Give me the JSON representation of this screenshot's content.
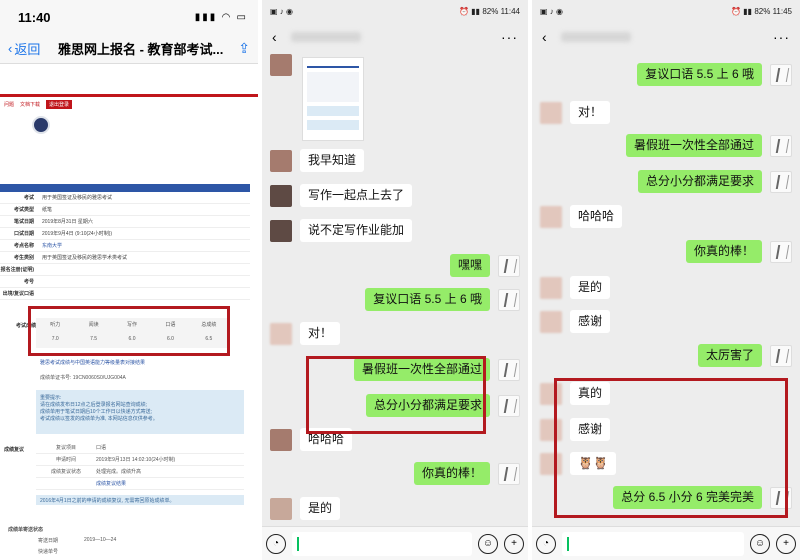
{
  "panel1": {
    "status_time": "11:40",
    "back_label": "返回",
    "title": "雅思网上报名 - 教育部考试...",
    "links": [
      "问题",
      "文档下载",
      "退出登录"
    ],
    "rows": [
      {
        "k": "考试",
        "v": "用于英国签证及移民的雅思考试"
      },
      {
        "k": "考试类型",
        "v": "纸笔"
      },
      {
        "k": "笔试日期",
        "v": "2019年8月31日 星期六"
      },
      {
        "k": "口试日期",
        "v": "2019年9月4日 (9:10(24小时制))"
      },
      {
        "k": "考点名称",
        "v": "东南大学"
      },
      {
        "k": "考生类别",
        "v": "用于英国签证及移民的雅思学术类考试"
      },
      {
        "k": "报名注册(证明)",
        "v": ""
      },
      {
        "k": "考号",
        "v": ""
      },
      {
        "k": "出境/复议口语",
        "v": ""
      }
    ],
    "score_label": "考试成绩",
    "score_headers": [
      "听力",
      "阅读",
      "写作",
      "口语",
      "总成绩"
    ],
    "score_values": [
      "7.0",
      "7.5",
      "6.0",
      "6.0",
      "6.5"
    ],
    "score_note": "雅思考试成绩与中国英语能力等级量表对接结果",
    "report_no": "成绩单证书号: 19CN0060S0/UJG004A",
    "notice_title": "重要提示:",
    "notice_lines": [
      "请在成绩发布日12点之后登录报名网站查询成绩;",
      "成绩单用于笔试日期后10个工作日以快递方式寄送;",
      "考试成绩以签发的成绩单为准, 本网站信息仅供参考。"
    ],
    "recheck_label": "成绩复议",
    "recheck_rows": [
      {
        "k": "复议项目",
        "v": "口语"
      },
      {
        "k": "申请时间",
        "v": "2019年9月13日 14:02:10(24小时制)"
      },
      {
        "k": "成绩复议状态",
        "v": "处理完成。成绩升高"
      },
      {
        "k": "",
        "v": "成绩复议结果"
      }
    ],
    "recheck_note": "2016年4月1日之前的申请的成绩复议, 无需寄回原始成绩单。",
    "express_label": "成绩单寄送状态",
    "express_rows": [
      {
        "k": "寄送日期",
        "v": "2019—10—24"
      },
      {
        "k": "快递单号",
        "v": ""
      }
    ]
  },
  "panel2": {
    "status_time": "11:44",
    "battery": "82%",
    "messages": [
      {
        "side": "l",
        "text": "我早知道"
      },
      {
        "side": "l",
        "text": "写作一起点上去了"
      },
      {
        "side": "l",
        "text": "说不定写作业能加"
      },
      {
        "side": "r",
        "text": "嘿嘿"
      },
      {
        "side": "r",
        "text": "复议口语 5.5 上 6 哦"
      },
      {
        "side": "l",
        "text": "对！"
      },
      {
        "side": "r",
        "text": "暑假班一次性全部通过"
      },
      {
        "side": "r",
        "text": "总分小分都满足要求"
      },
      {
        "side": "l",
        "text": "哈哈哈"
      },
      {
        "side": "r",
        "text": "你真的棒！"
      },
      {
        "side": "l",
        "text": "是的"
      }
    ]
  },
  "panel3": {
    "status_time": "11:45",
    "battery": "82%",
    "messages": [
      {
        "side": "r",
        "text": "复议口语 5.5 上 6 哦"
      },
      {
        "side": "l",
        "text": "对！"
      },
      {
        "side": "r",
        "text": "暑假班一次性全部通过"
      },
      {
        "side": "r",
        "text": "总分小分都满足要求"
      },
      {
        "side": "l",
        "text": "哈哈哈"
      },
      {
        "side": "r",
        "text": "你真的棒！"
      },
      {
        "side": "l",
        "text": "是的"
      },
      {
        "side": "l",
        "text": "感谢"
      },
      {
        "side": "r",
        "text": "太厉害了"
      },
      {
        "side": "l",
        "text": "真的"
      },
      {
        "side": "l",
        "text": "感谢"
      },
      {
        "side": "l",
        "text": "🦉🦉"
      },
      {
        "side": "r",
        "text": "总分 6.5 小分 6 完美完美"
      }
    ]
  }
}
